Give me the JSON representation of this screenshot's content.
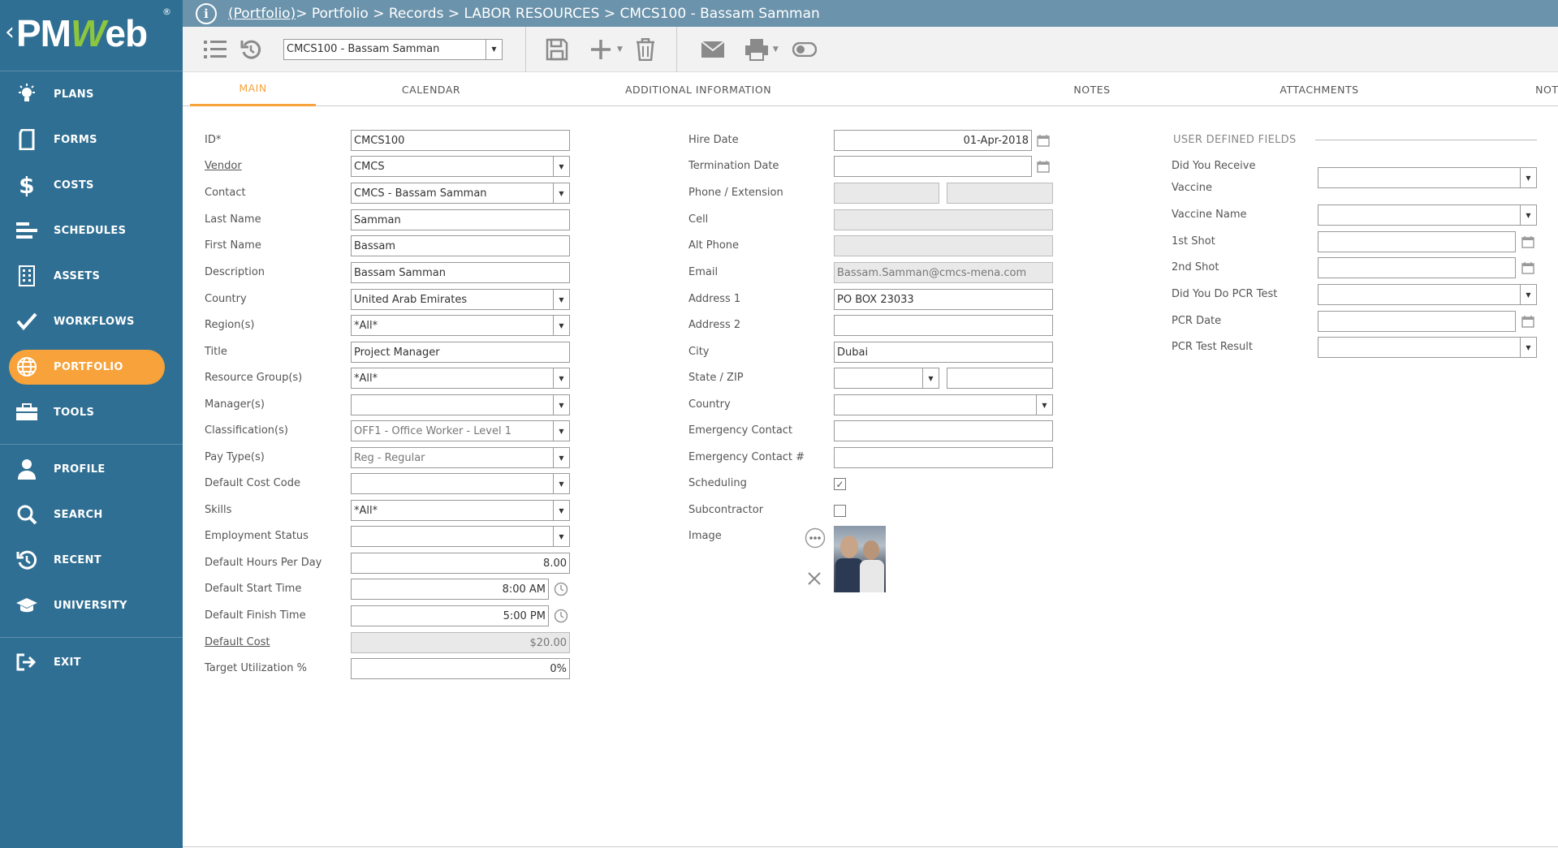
{
  "sidebar": {
    "logo_text_a": "PM",
    "logo_text_b": "W",
    "logo_text_c": "eb",
    "items": [
      {
        "label": "PLANS",
        "icon": "bulb-icon"
      },
      {
        "label": "FORMS",
        "icon": "document-icon"
      },
      {
        "label": "COSTS",
        "icon": "dollar-icon"
      },
      {
        "label": "SCHEDULES",
        "icon": "gantt-icon"
      },
      {
        "label": "ASSETS",
        "icon": "building-icon"
      },
      {
        "label": "WORKFLOWS",
        "icon": "check-icon"
      },
      {
        "label": "PORTFOLIO",
        "icon": "globe-icon"
      },
      {
        "label": "TOOLS",
        "icon": "toolbox-icon"
      },
      {
        "label": "PROFILE",
        "icon": "person-icon"
      },
      {
        "label": "SEARCH",
        "icon": "search-icon"
      },
      {
        "label": "RECENT",
        "icon": "history-icon"
      },
      {
        "label": "UNIVERSITY",
        "icon": "graduation-cap-icon"
      },
      {
        "label": "EXIT",
        "icon": "exit-icon"
      }
    ],
    "accent": "#f7a23a",
    "bg": "#2f6f93"
  },
  "breadcrumb": {
    "link": "(Portfolio)",
    "rest": " > Portfolio > Records > LABOR RESOURCES > CMCS100 - Bassam Samman"
  },
  "toolbar": {
    "record_select": "CMCS100 - Bassam Samman"
  },
  "tabs": [
    "MAIN",
    "CALENDAR",
    "ADDITIONAL INFORMATION",
    "NOTES",
    "ATTACHMENTS",
    "NOTIFICATIONS"
  ],
  "col1": {
    "id_label": "ID*",
    "id_value": "CMCS100",
    "vendor_label": "Vendor",
    "vendor_value": "CMCS",
    "contact_label": "Contact",
    "contact_value": "CMCS - Bassam Samman",
    "last_name_label": "Last Name",
    "last_name_value": "Samman",
    "first_name_label": "First Name",
    "first_name_value": "Bassam",
    "description_label": "Description",
    "description_value": "Bassam Samman",
    "country_label": "Country",
    "country_value": "United Arab Emirates",
    "regions_label": "Region(s)",
    "regions_value": "*All*",
    "title_label": "Title",
    "title_value": "Project Manager",
    "resource_groups_label": "Resource Group(s)",
    "resource_groups_value": "*All*",
    "managers_label": "Manager(s)",
    "managers_value": "",
    "classifications_label": "Classification(s)",
    "classifications_value": "OFF1 - Office Worker - Level 1",
    "pay_types_label": "Pay Type(s)",
    "pay_types_value": "Reg - Regular",
    "default_cost_code_label": "Default Cost Code",
    "default_cost_code_value": "",
    "skills_label": "Skills",
    "skills_value": "*All*",
    "employment_status_label": "Employment Status",
    "employment_status_value": "",
    "hours_per_day_label": "Default Hours Per Day",
    "hours_per_day_value": "8.00",
    "start_time_label": "Default Start Time",
    "start_time_value": "8:00 AM",
    "finish_time_label": "Default Finish Time",
    "finish_time_value": "5:00 PM",
    "default_cost_label": "Default Cost",
    "default_cost_value": "$20.00",
    "target_util_label": "Target Utilization %",
    "target_util_value": "0%"
  },
  "col2": {
    "hire_date_label": "Hire Date",
    "hire_date_value": "01-Apr-2018",
    "termination_date_label": "Termination Date",
    "termination_date_value": "",
    "phone_label": "Phone / Extension",
    "phone_value": "",
    "extension_value": "",
    "cell_label": "Cell",
    "cell_value": "",
    "alt_phone_label": "Alt Phone",
    "alt_phone_value": "",
    "email_label": "Email",
    "email_value": "Bassam.Samman@cmcs-mena.com",
    "address1_label": "Address 1",
    "address1_value": "PO BOX 23033",
    "address2_label": "Address 2",
    "address2_value": "",
    "city_label": "City",
    "city_value": "Dubai",
    "state_zip_label": "State / ZIP",
    "state_value": "",
    "zip_value": "",
    "country_label": "Country",
    "country_value": "",
    "emergency_contact_label": "Emergency Contact",
    "emergency_contact_value": "",
    "emergency_contact_no_label": "Emergency Contact #",
    "emergency_contact_no_value": "",
    "scheduling_label": "Scheduling",
    "scheduling_checked": true,
    "subcontractor_label": "Subcontractor",
    "subcontractor_checked": false,
    "image_label": "Image"
  },
  "col3": {
    "header": "USER DEFINED FIELDS",
    "vaccine_q_label_1": "Did You Receive",
    "vaccine_q_label_2": "Vaccine",
    "vaccine_q_value": "",
    "vaccine_name_label": "Vaccine Name",
    "vaccine_name_value": "",
    "first_shot_label": "1st Shot",
    "first_shot_value": "",
    "second_shot_label": "2nd Shot",
    "second_shot_value": "",
    "pcr_q_label": "Did You Do PCR Test",
    "pcr_q_value": "",
    "pcr_date_label": "PCR Date",
    "pcr_date_value": "",
    "pcr_result_label": "PCR Test Result",
    "pcr_result_value": ""
  }
}
